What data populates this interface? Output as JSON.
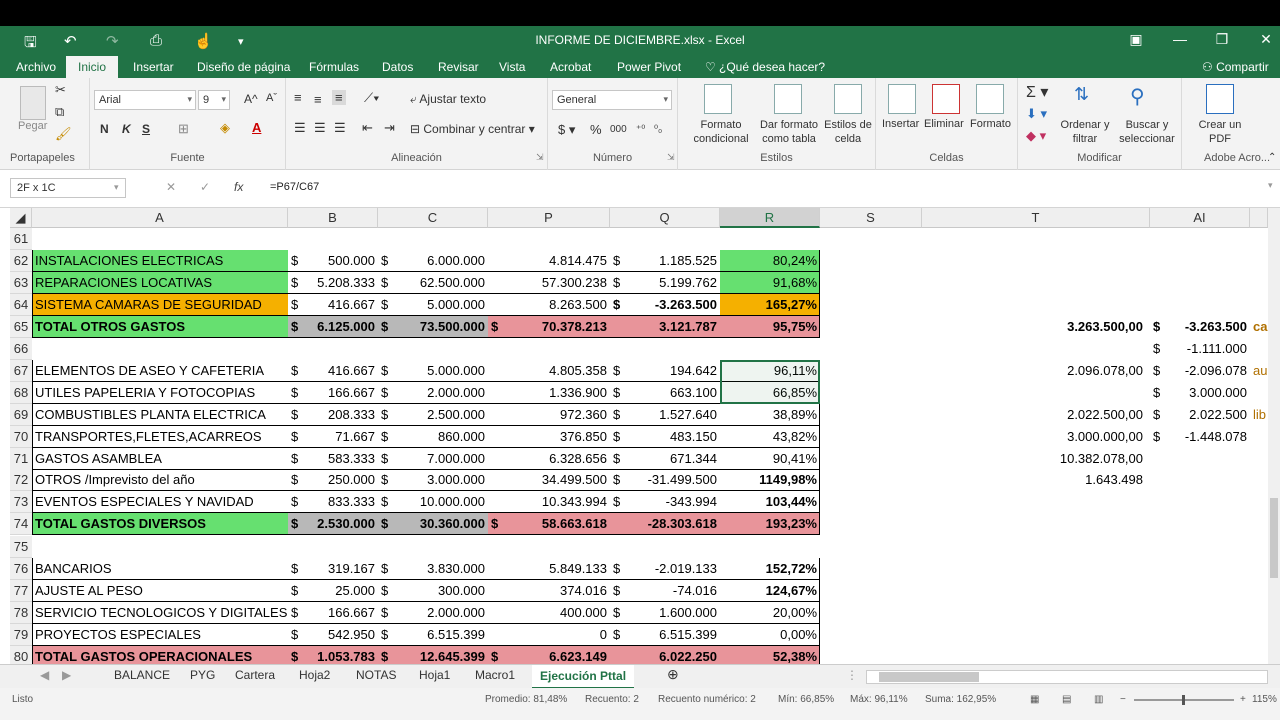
{
  "window": {
    "title": "INFORME DE DICIEMBRE.xlsx - Excel"
  },
  "tabs": [
    {
      "label": "Archivo"
    },
    {
      "label": "Inicio"
    },
    {
      "label": "Insertar"
    },
    {
      "label": "Diseño de página"
    },
    {
      "label": "Fórmulas"
    },
    {
      "label": "Datos"
    },
    {
      "label": "Revisar"
    },
    {
      "label": "Vista"
    },
    {
      "label": "Acrobat"
    },
    {
      "label": "Power Pivot"
    }
  ],
  "tell_me": "¿Qué desea hacer?",
  "share": "Compartir",
  "ribbon": {
    "paste": "Pegar",
    "clipboard": "Portapapeles",
    "font_name": "Arial",
    "font_size": "9",
    "font_group": "Fuente",
    "bold": "N",
    "italic": "K",
    "underline": "S",
    "wrap_text": "Ajustar texto",
    "merge_center": "Combinar y centrar",
    "alignment_group": "Alineación",
    "number_format": "General",
    "number_group": "Número",
    "cond_format": "Formato condicional",
    "format_table": "Dar formato como tabla",
    "cell_styles": "Estilos de celda",
    "styles_group": "Estilos",
    "insert": "Insertar",
    "delete": "Eliminar",
    "format": "Formato",
    "cells_group": "Celdas",
    "sort_filter": "Ordenar y filtrar",
    "find_select": "Buscar y seleccionar",
    "modify_group": "Modificar",
    "create_pdf": "Crear un PDF",
    "adobe_group": "Adobe Acro..."
  },
  "formula_bar": {
    "name_box": "2F x 1C",
    "fx": "fx",
    "formula": "=P67/C67"
  },
  "columns": [
    "A",
    "B",
    "C",
    "P",
    "Q",
    "R",
    "S",
    "T",
    "AI"
  ],
  "rows": [
    {
      "n": "61",
      "cells": {}
    },
    {
      "n": "62",
      "cells": {
        "A": "INSTALACIONES ELECTRICAS",
        "B$": "$",
        "B": "500.000",
        "C$": "$",
        "C": "6.000.000",
        "P": "4.814.475",
        "Q$": "$",
        "Q": "1.185.525",
        "R": "80,24%"
      },
      "colors": {
        "A": "#66e070",
        "R": "#66e070"
      }
    },
    {
      "n": "63",
      "cells": {
        "A": "REPARACIONES LOCATIVAS",
        "B$": "$",
        "B": "5.208.333",
        "C$": "$",
        "C": "62.500.000",
        "P": "57.300.238",
        "Q$": "$",
        "Q": "5.199.762",
        "R": "91,68%"
      },
      "colors": {
        "A": "#66e070",
        "R": "#66e070"
      }
    },
    {
      "n": "64",
      "cells": {
        "A": "SISTEMA CAMARAS DE SEGURIDAD",
        "B$": "$",
        "B": "416.667",
        "C$": "$",
        "C": "5.000.000",
        "P": "8.263.500",
        "Q$": "$",
        "Q": "-3.263.500",
        "R": "165,27%"
      },
      "colors": {
        "A": "#f5b000",
        "R": "#f5b000"
      },
      "boldQ": true,
      "boldR": true
    },
    {
      "n": "65",
      "cells": {
        "A": "TOTAL OTROS GASTOS",
        "B$": "$",
        "B": "6.125.000",
        "C$": "$",
        "C": "73.500.000",
        "P$": "$",
        "P": "70.378.213",
        "Q": "3.121.787",
        "R": "95,75%",
        "T": "3.263.500,00",
        "AI$": "$",
        "AI": "-3.263.500",
        "AJ": "ca"
      },
      "colors": {
        "A": "#66e070",
        "B": "#b8b8b8",
        "C": "#b8b8b8",
        "P": "#e8949a",
        "Q": "#e8949a",
        "R": "#e8949a"
      },
      "bold": true
    },
    {
      "n": "66",
      "cells": {
        "AI$": "$",
        "AI": "-1.111.000"
      }
    },
    {
      "n": "67",
      "cells": {
        "A": "ELEMENTOS DE ASEO Y CAFETERIA",
        "B$": "$",
        "B": "416.667",
        "C$": "$",
        "C": "5.000.000",
        "P": "4.805.358",
        "Q$": "$",
        "Q": "194.642",
        "R": "96,11%",
        "T": "2.096.078,00",
        "AI$": "$",
        "AI": "-2.096.078",
        "AJ": "au"
      }
    },
    {
      "n": "68",
      "cells": {
        "A": "UTILES PAPELERIA Y FOTOCOPIAS",
        "B$": "$",
        "B": "166.667",
        "C$": "$",
        "C": "2.000.000",
        "P": "1.336.900",
        "Q$": "$",
        "Q": "663.100",
        "R": "66,85%",
        "AI$": "$",
        "AI": "3.000.000"
      }
    },
    {
      "n": "69",
      "cells": {
        "A": "COMBUSTIBLES PLANTA ELECTRICA",
        "B$": "$",
        "B": "208.333",
        "C$": "$",
        "C": "2.500.000",
        "P": "972.360",
        "Q$": "$",
        "Q": "1.527.640",
        "R": "38,89%",
        "T": "2.022.500,00",
        "AI$": "$",
        "AI": "2.022.500",
        "AJ": "lib"
      }
    },
    {
      "n": "70",
      "cells": {
        "A": "TRANSPORTES,FLETES,ACARREOS",
        "B$": "$",
        "B": "71.667",
        "C$": "$",
        "C": "860.000",
        "P": "376.850",
        "Q$": "$",
        "Q": "483.150",
        "R": "43,82%",
        "T": "3.000.000,00",
        "AI$": "$",
        "AI": "-1.448.078"
      }
    },
    {
      "n": "71",
      "cells": {
        "A": "GASTOS ASAMBLEA",
        "B$": "$",
        "B": "583.333",
        "C$": "$",
        "C": "7.000.000",
        "P": "6.328.656",
        "Q$": "$",
        "Q": "671.344",
        "R": "90,41%",
        "T": "10.382.078,00"
      }
    },
    {
      "n": "72",
      "cells": {
        "A": "OTROS /Imprevisto del año",
        "B$": "$",
        "B": "250.000",
        "C$": "$",
        "C": "3.000.000",
        "P": "34.499.500",
        "Q$": "$",
        "Q": "-31.499.500",
        "R": "1149,98%",
        "T": "1.643.498"
      },
      "boldR": true
    },
    {
      "n": "73",
      "cells": {
        "A": "EVENTOS ESPECIALES Y NAVIDAD",
        "B$": "$",
        "B": "833.333",
        "C$": "$",
        "C": "10.000.000",
        "P": "10.343.994",
        "Q$": "$",
        "Q": "-343.994",
        "R": "103,44%"
      },
      "boldR": true
    },
    {
      "n": "74",
      "cells": {
        "A": "TOTAL GASTOS DIVERSOS",
        "B$": "$",
        "B": "2.530.000",
        "C$": "$",
        "C": "30.360.000",
        "P$": "$",
        "P": "58.663.618",
        "Q": "-28.303.618",
        "R": "193,23%"
      },
      "colors": {
        "A": "#66e070",
        "B": "#b8b8b8",
        "C": "#b8b8b8",
        "P": "#e8949a",
        "Q": "#e8949a",
        "R": "#e8949a"
      },
      "bold": true
    },
    {
      "n": "75",
      "cells": {}
    },
    {
      "n": "76",
      "cells": {
        "A": "BANCARIOS",
        "B$": "$",
        "B": "319.167",
        "C$": "$",
        "C": "3.830.000",
        "P": "5.849.133",
        "Q$": "$",
        "Q": "-2.019.133",
        "R": "152,72%"
      },
      "boldR": true
    },
    {
      "n": "77",
      "cells": {
        "A": "AJUSTE AL PESO",
        "B$": "$",
        "B": "25.000",
        "C$": "$",
        "C": "300.000",
        "P": "374.016",
        "Q$": "$",
        "Q": "-74.016",
        "R": "124,67%"
      },
      "boldR": true
    },
    {
      "n": "78",
      "cells": {
        "A": "SERVICIO TECNOLOGICOS Y DIGITALES",
        "B$": "$",
        "B": "166.667",
        "C$": "$",
        "C": "2.000.000",
        "P": "400.000",
        "Q$": "$",
        "Q": "1.600.000",
        "R": "20,00%"
      }
    },
    {
      "n": "79",
      "cells": {
        "A": "PROYECTOS ESPECIALES",
        "B$": "$",
        "B": "542.950",
        "C$": "$",
        "C": "6.515.399",
        "P": "0",
        "Q$": "$",
        "Q": "6.515.399",
        "R": "0,00%"
      }
    },
    {
      "n": "80",
      "cells": {
        "A": "TOTAL GASTOS OPERACIONALES",
        "B$": "$",
        "B": "1.053.783",
        "C$": "$",
        "C": "12.645.399",
        "P$": "$",
        "P": "6.623.149",
        "Q": "6.022.250",
        "R": "52,38%"
      },
      "colors": {
        "A": "#e8949a",
        "B": "#e8949a",
        "C": "#e8949a",
        "P": "#e8949a",
        "Q": "#e8949a",
        "R": "#e8949a"
      },
      "bold": true
    }
  ],
  "sheets": [
    "BALANCE",
    "PYG",
    "Cartera",
    "Hoja2",
    "NOTAS",
    "Hoja1",
    "Macro1",
    "Ejecución Pttal"
  ],
  "active_sheet": "Ejecución Pttal",
  "status": {
    "mode": "Listo",
    "average": "Promedio: 81,48%",
    "count": "Recuento: 2",
    "num_count": "Recuento numérico: 2",
    "min": "Mín: 66,85%",
    "max": "Máx: 96,11%",
    "sum": "Suma: 162,95%",
    "zoom": "115%"
  }
}
